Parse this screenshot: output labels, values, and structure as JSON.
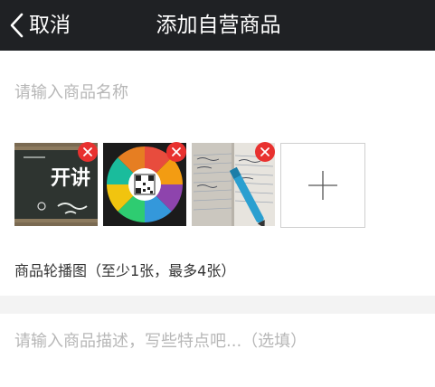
{
  "header": {
    "back_label": "取消",
    "title": "添加自营商品"
  },
  "form": {
    "name_placeholder": "请输入商品名称",
    "images_caption": "商品轮播图（至少1张，最多4张）",
    "description_placeholder": "请输入商品描述，写些特点吧...（选填）"
  },
  "images": [
    {
      "kind": "chalkboard",
      "text": "开讲"
    },
    {
      "kind": "color-wheel-qr"
    },
    {
      "kind": "notebook-pen"
    }
  ],
  "icons": {
    "back": "chevron-left-icon",
    "delete": "close-icon",
    "add": "plus-icon"
  },
  "colors": {
    "header_bg": "#1f2124",
    "delete_badge": "#e8312f",
    "placeholder_text": "#b7b7b7"
  }
}
